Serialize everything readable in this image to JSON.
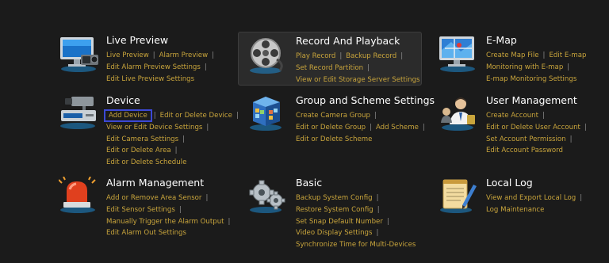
{
  "sections": {
    "live_preview": {
      "title": "Live Preview",
      "links": [
        "Live Preview",
        "Alarm Preview",
        "Edit Alarm Preview Settings",
        "Edit Live Preview Settings"
      ]
    },
    "record_playback": {
      "title": "Record And Playback",
      "links": [
        "Play Record",
        "Backup Record",
        "Set Record Partition",
        "View or Edit Storage Server Settings"
      ]
    },
    "emap": {
      "title": "E-Map",
      "links": [
        "Create Map File",
        "Edit E-map",
        "Monitoring with E-map",
        "E-map Monitoring Settings"
      ]
    },
    "device": {
      "title": "Device",
      "links": [
        "Add Device",
        "Edit or Delete Device",
        "View or Edit Device Settings",
        "Edit Camera Settings",
        "Edit or Delete Area",
        "Edit or Delete Schedule"
      ]
    },
    "group_scheme": {
      "title": "Group and Scheme Settings",
      "links": [
        "Create Camera Group",
        "Edit or Delete Group",
        "Add Scheme",
        "Edit or Delete Scheme"
      ]
    },
    "user_management": {
      "title": "User Management",
      "links": [
        "Create Account",
        "Edit or Delete User Account",
        "Set Account Permission",
        "Edit Account Password"
      ]
    },
    "alarm_management": {
      "title": "Alarm Management",
      "links": [
        "Add or Remove Area Sensor",
        "Edit Sensor Settings",
        "Manually Trigger the Alarm Output",
        "Edit Alarm Out Settings"
      ]
    },
    "basic": {
      "title": "Basic",
      "links": [
        "Backup System Config",
        "Restore System Config",
        "Set Snap Default Number",
        "Video Display Settings",
        "Synchronize Time for Multi-Devices"
      ]
    },
    "local_log": {
      "title": "Local Log",
      "links": [
        "View and Export Local Log",
        "Log Maintenance"
      ]
    }
  },
  "icons": {
    "live_preview": "monitor-camera-icon",
    "record_playback": "film-reel-icon",
    "emap": "map-monitor-icon",
    "device": "dvr-camera-icon",
    "group_scheme": "camera-grid-cube-icon",
    "user_management": "user-admin-icon",
    "alarm_management": "alarm-siren-icon",
    "basic": "gears-icon",
    "local_log": "notepad-pencil-icon"
  },
  "colors": {
    "background": "#1b1b1b",
    "title": "#ffffff",
    "link": "#c9a53c",
    "separator": "#8e8e8e",
    "selection_border": "#3c49d6",
    "highlight_panel": "#2b2b2b"
  }
}
